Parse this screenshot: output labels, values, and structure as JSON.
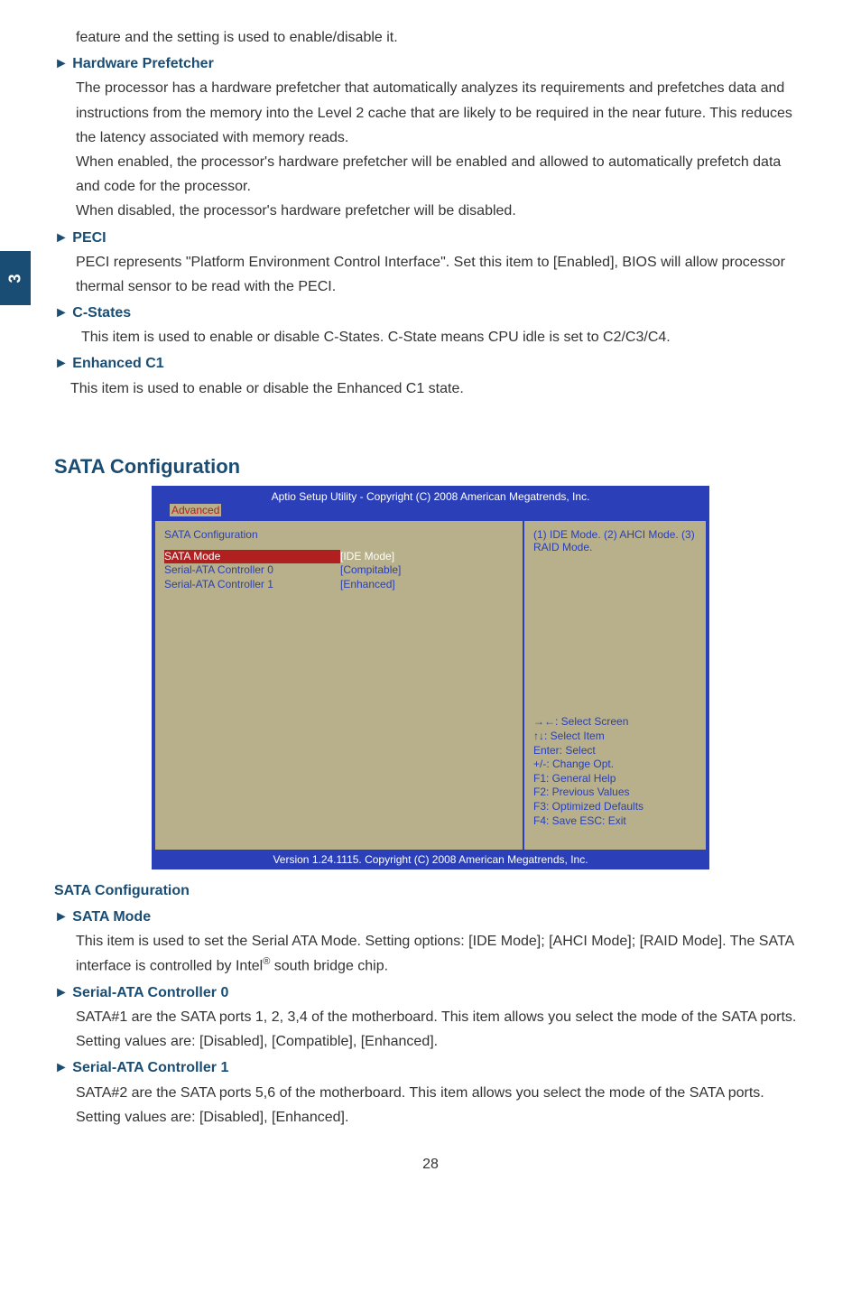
{
  "sideTab": "3",
  "intro": {
    "line1": "feature and the setting is used to enable/disable it."
  },
  "items": {
    "hwPrefetch": {
      "title": "► Hardware Prefetcher",
      "p1": "The processor has a hardware prefetcher that automatically analyzes its requirements and prefetches data and instructions from the memory into the Level 2 cache that are likely to be required in the near future. This reduces the latency associated with memory reads.",
      "p2": "When enabled, the processor's hardware prefetcher will be enabled and allowed to automatically prefetch data and code for the processor.",
      "p3": "When disabled, the processor's hardware prefetcher will be disabled."
    },
    "peci": {
      "title": "► PECI",
      "p1": "PECI represents \"Platform Environment Control Interface\". Set this item to [Enabled], BIOS will allow processor thermal sensor to be read with the PECI."
    },
    "cstates": {
      "title": "► C-States",
      "p1": "This item is used to enable or disable C-States. C-State means CPU idle is set to C2/C3/C4."
    },
    "enhC1": {
      "title": "► Enhanced C1",
      "p1": "This item is used to enable or disable the Enhanced C1 state."
    }
  },
  "sectionTitle": "SATA Configuration",
  "bios": {
    "header": "Aptio Setup Utility - Copyright (C) 2008 American Megatrends, Inc.",
    "tab": "Advanced",
    "leftTitle": "SATA Configuration",
    "rows": [
      {
        "label": "SATA Mode",
        "value": "[IDE Mode]",
        "highlight": true
      },
      {
        "label": "Serial-ATA Controller 0",
        "value": "[Compitable]",
        "highlight": false
      },
      {
        "label": "Serial-ATA Controller 1",
        "value": "[Enhanced]",
        "highlight": false
      }
    ],
    "rightTop": "(1) IDE Mode. (2) AHCI Mode. (3) RAID Mode.",
    "help": [
      "→←: Select Screen",
      "↑↓: Select Item",
      "Enter: Select",
      "+/-: Change Opt.",
      "F1:  General Help",
      "F2:  Previous Values",
      "F3: Optimized Defaults",
      "F4: Save  ESC: Exit"
    ],
    "footer": "Version 1.24.1115. Copyright (C) 2008 American Megatrends, Inc."
  },
  "sataSection": {
    "heading": "SATA Configuration",
    "sataMode": {
      "title": "► SATA Mode",
      "p_a": "This item is used to set the Serial ATA Mode. Setting options: [IDE Mode]; [AHCI Mode]; [RAID Mode]. The SATA interface is controlled by Intel",
      "sup": "®",
      "p_b": " south bridge chip."
    },
    "ctrl0": {
      "title": "► Serial-ATA Controller 0",
      "p": "SATA#1 are the SATA ports 1, 2, 3,4 of the motherboard. This item allows you select the mode of the SATA ports. Setting values are: [Disabled], [Compatible], [Enhanced]."
    },
    "ctrl1": {
      "title": "► Serial-ATA Controller 1",
      "p": "SATA#2 are the SATA ports 5,6 of the motherboard. This item allows you select the mode of the SATA ports. Setting values are: [Disabled], [Enhanced]."
    }
  },
  "pageNum": "28"
}
